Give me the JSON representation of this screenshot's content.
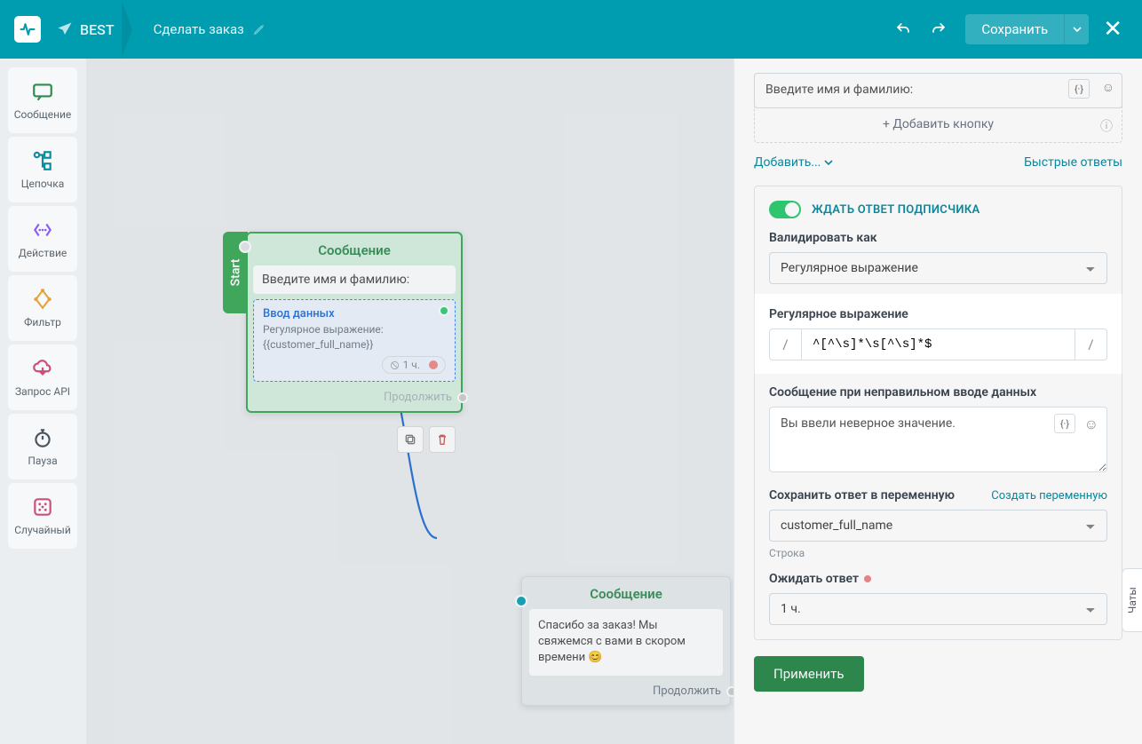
{
  "header": {
    "bot_name": "BEST",
    "flow_name": "Сделать заказ",
    "save": "Сохранить"
  },
  "toolbar": {
    "message": "Сообщение",
    "chain": "Цепочка",
    "action": "Действие",
    "filter": "Фильтр",
    "api": "Запрос API",
    "pause": "Пауза",
    "random": "Случайный"
  },
  "canvas": {
    "start": "Start",
    "node1": {
      "title": "Сообщение",
      "text": "Введите имя и фамилию:",
      "input_title": "Ввод данных",
      "input_sub1": "Регулярное выражение:",
      "input_sub2": "{{customer_full_name}}",
      "time": "1 ч.",
      "continue": "Продолжить"
    },
    "node2": {
      "title": "Сообщение",
      "text": "Спасибо за заказ! Мы свяжемся с вами в скором времени 😊",
      "continue": "Продолжить"
    }
  },
  "panel": {
    "text_placeholder": "Введите имя и фамилию:",
    "add_button": "+ Добавить кнопку",
    "add_link": "Добавить...",
    "quick_replies": "Быстрые ответы",
    "wait_label": "ЖДАТЬ ОТВЕТ ПОДПИСЧИКА",
    "validate_label": "Валидировать как",
    "validate_value": "Регулярное выражение",
    "regex_label": "Регулярное выражение",
    "regex_value": "^[^\\s]*\\s[^\\s]*$",
    "invalid_label": "Сообщение при неправильном вводе данных",
    "invalid_value": "Вы ввели неверное значение.",
    "save_var_label": "Сохранить ответ в переменную",
    "create_var": "Создать переменную",
    "var_value": "customer_full_name",
    "var_hint": "Строка",
    "wait_time_label": "Ожидать ответ",
    "wait_time_value": "1 ч.",
    "apply": "Применить",
    "code_btn": "{·}"
  },
  "chat_tab": "Чаты"
}
